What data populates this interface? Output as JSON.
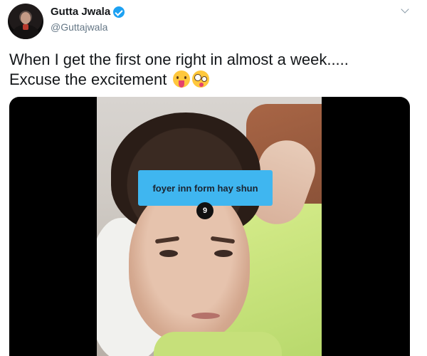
{
  "tweet": {
    "display_name": "Gutta Jwala",
    "handle": "@Guttajwala",
    "text_line1": "When I get the first one right in almost a week.....",
    "text_line2": "Excuse the excitement",
    "emojis": [
      "face-with-tongue-emoji",
      "zany-face-emoji"
    ]
  },
  "media": {
    "caption": "foyer inn form hay shun",
    "count": "9"
  },
  "colors": {
    "verified": "#1da1f2",
    "caption_box": "#3fb6f0",
    "handle": "#657786",
    "text": "#14171a"
  }
}
